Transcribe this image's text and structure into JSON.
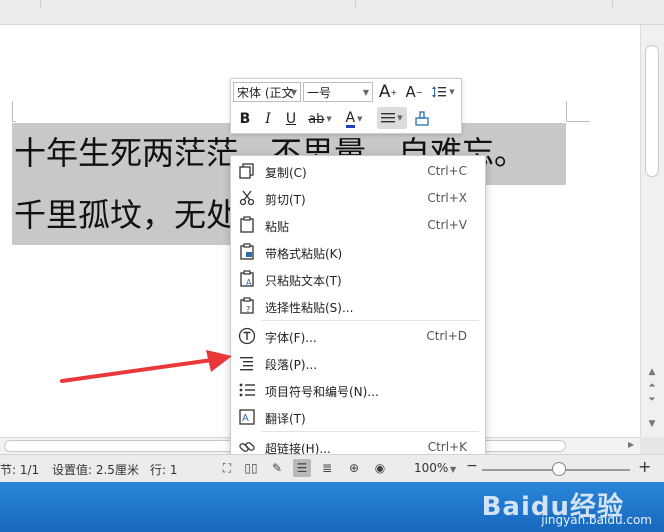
{
  "colors": {
    "arrow": "#e8383a",
    "selection": "#c8c8c8",
    "taskbar": "#1f75cc"
  },
  "document": {
    "lines": [
      "十年生死两茫茫，不思量，自难忘。",
      "千里孤坟，无处话凄凉。"
    ]
  },
  "mini_toolbar": {
    "font_name": "宋体 (正文",
    "font_size": "一号",
    "grow_font": "A",
    "shrink_font": "A",
    "bold": "B",
    "italic": "I",
    "underline": "U",
    "strikethrough": "ab",
    "font_color": "A"
  },
  "context_menu": {
    "items": [
      {
        "label": "复制(C)",
        "shortcut": "Ctrl+C",
        "icon": "copy-icon"
      },
      {
        "label": "剪切(T)",
        "shortcut": "Ctrl+X",
        "icon": "scissors-icon"
      },
      {
        "label": "粘贴",
        "shortcut": "Ctrl+V",
        "icon": "paste-icon"
      },
      {
        "label": "带格式粘贴(K)",
        "shortcut": "",
        "icon": "paste-format-icon"
      },
      {
        "label": "只粘贴文本(T)",
        "shortcut": "",
        "icon": "paste-text-icon"
      },
      {
        "label": "选择性粘贴(S)...",
        "shortcut": "",
        "icon": "paste-special-icon"
      },
      {
        "label": "字体(F)...",
        "shortcut": "Ctrl+D",
        "icon": "font-icon"
      },
      {
        "label": "段落(P)...",
        "shortcut": "",
        "icon": "paragraph-icon"
      },
      {
        "label": "项目符号和编号(N)...",
        "shortcut": "",
        "icon": "bullets-icon"
      },
      {
        "label": "翻译(T)",
        "shortcut": "",
        "icon": "translate-icon"
      },
      {
        "label": "超链接(H)...",
        "shortcut": "Ctrl+K",
        "icon": "link-icon"
      }
    ]
  },
  "status_bar": {
    "section": "节: 1/1",
    "setting": "设置值: 2.5厘米",
    "row": "行: 1",
    "zoom": "100%",
    "zoom_minus": "−",
    "zoom_plus": "+"
  },
  "watermark": {
    "brand": "Baidu经验",
    "url": "jingyan.baidu.com"
  }
}
